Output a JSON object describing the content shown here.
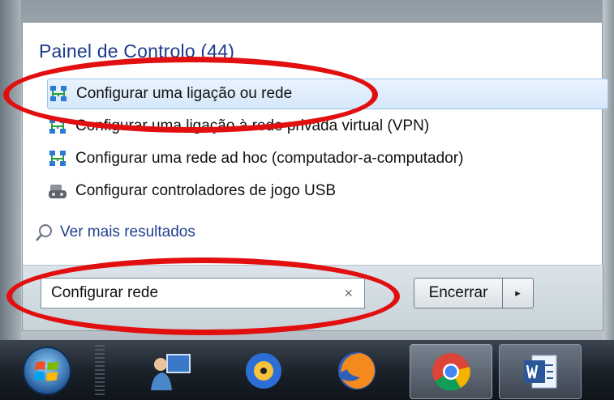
{
  "start_menu": {
    "section_title": "Painel de Controlo (44)",
    "results": [
      {
        "label": "Configurar uma ligação ou rede",
        "icon": "network-icon",
        "highlighted": true
      },
      {
        "label": "Configurar uma ligação à rede privada virtual (VPN)",
        "icon": "network-icon"
      },
      {
        "label": "Configurar uma rede ad hoc (computador-a-computador)",
        "icon": "network-icon"
      },
      {
        "label": "Configurar controladores de jogo USB",
        "icon": "game-controller-icon"
      }
    ],
    "see_more": "Ver mais resultados",
    "search": {
      "value": "Configurar rede",
      "clear_icon": "×"
    },
    "shutdown": {
      "label": "Encerrar",
      "arrow": "▸"
    }
  },
  "taskbar": {
    "items": [
      {
        "name": "start-orb",
        "icon": "windows-logo-icon"
      },
      {
        "name": "app-remote-desktop",
        "icon": "user-computer-icon"
      },
      {
        "name": "app-media-player",
        "icon": "media-disc-icon"
      },
      {
        "name": "app-firefox",
        "icon": "firefox-icon"
      },
      {
        "name": "app-chrome",
        "icon": "chrome-icon"
      },
      {
        "name": "app-word",
        "icon": "word-icon"
      }
    ]
  },
  "colors": {
    "accent": "#1e3a8a",
    "annotation": "#e10f0f",
    "highlight": "#d6e8fb"
  }
}
